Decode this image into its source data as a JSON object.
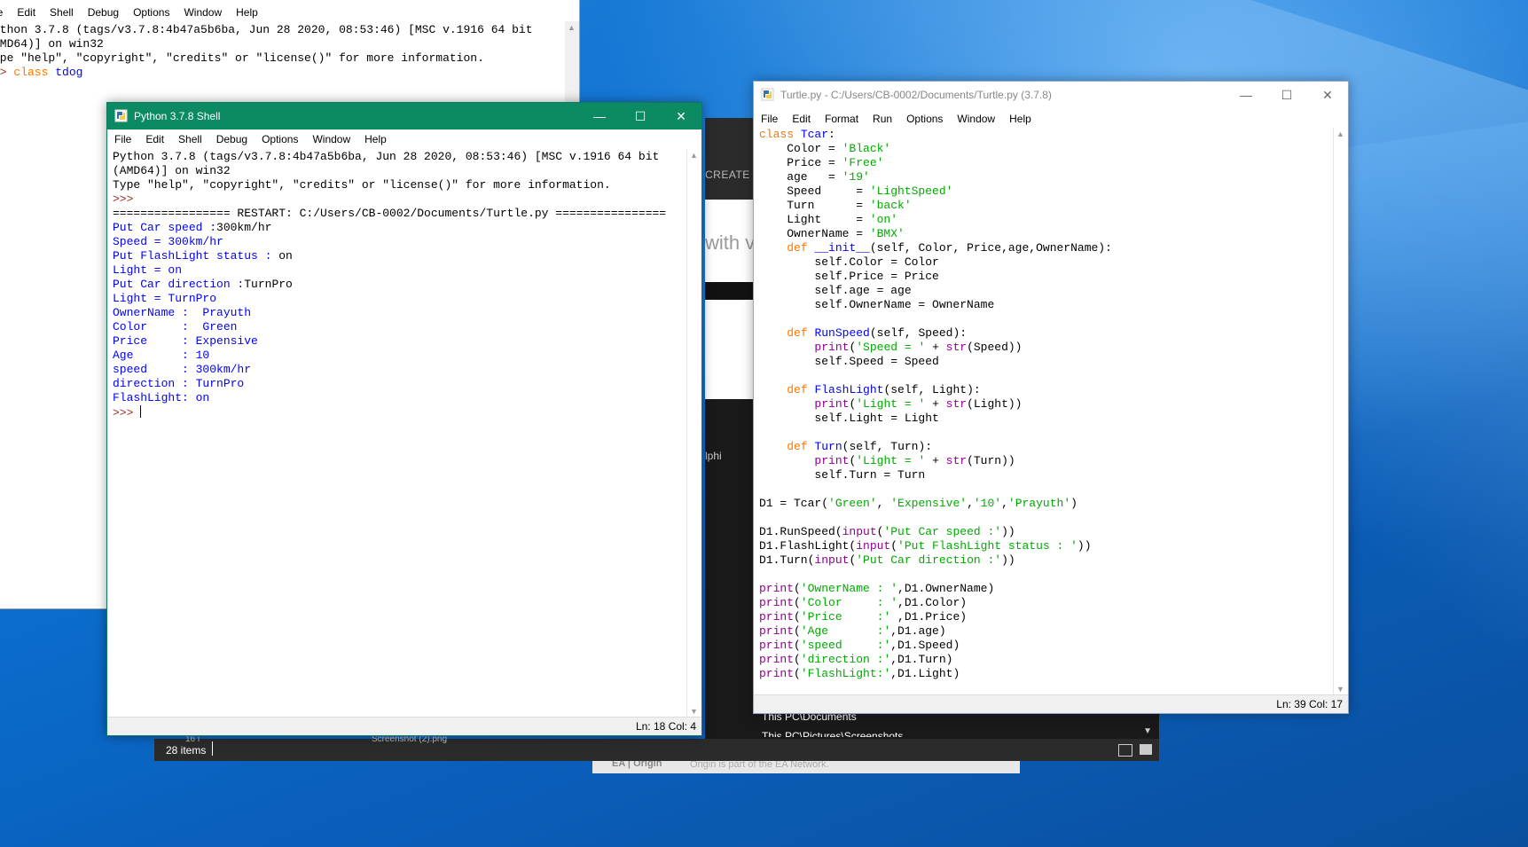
{
  "bg_shell": {
    "menu": [
      "le",
      "Edit",
      "Shell",
      "Debug",
      "Options",
      "Window",
      "Help"
    ],
    "lines": [
      [
        {
          "t": "ython 3.7.8 (tags/v3.7.8:4b47a5b6ba, Jun 28 2020, 08:53:46) [MSC v.1916 64 bit",
          "c": "blk"
        }
      ],
      [
        {
          "t": "AMD64)] on win32",
          "c": "blk"
        }
      ],
      [
        {
          "t": "ype \"help\", \"copyright\", \"credits\" or \"license()\" for more information.",
          "c": "blk"
        }
      ],
      [
        {
          "t": ">> ",
          "c": "prompt"
        },
        {
          "t": "class ",
          "c": "kw"
        },
        {
          "t": "tdog",
          "c": "def"
        }
      ]
    ]
  },
  "explorer": {
    "create_label": "CREATE A",
    "with_text": "with v",
    "lphi_text": "lphi",
    "path_documents": "This PC\\Documents",
    "path_screenshots": "This PC\\Pictures\\Screenshots",
    "item_count": "28 items",
    "partial_left": "16 i",
    "partial_file": "Screenshot (2).png"
  },
  "origin_strip": {
    "logo": "EA | Origin",
    "text": "Origin is part of the EA Network."
  },
  "shell": {
    "title": "Python 3.7.8 Shell",
    "menu": [
      "File",
      "Edit",
      "Shell",
      "Debug",
      "Options",
      "Window",
      "Help"
    ],
    "status": "Ln: 18   Col: 4",
    "lines": [
      [
        {
          "t": "Python 3.7.8 (tags/v3.7.8:4b47a5b6ba, Jun 28 2020, 08:53:46) [MSC v.1916 64 bit",
          "c": "blk"
        }
      ],
      [
        {
          "t": "(AMD64)] on win32",
          "c": "blk"
        }
      ],
      [
        {
          "t": "Type \"help\", \"copyright\", \"credits\" or \"license()\" for more information.",
          "c": "blk"
        }
      ],
      [
        {
          "t": ">>> ",
          "c": "prompt"
        }
      ],
      [
        {
          "t": "================= RESTART: C:/Users/CB-0002/Documents/Turtle.py ================",
          "c": "blk"
        }
      ],
      [
        {
          "t": "Put Car speed :",
          "c": "out"
        },
        {
          "t": "300km/hr",
          "c": "blk"
        }
      ],
      [
        {
          "t": "Speed = 300km/hr",
          "c": "out"
        }
      ],
      [
        {
          "t": "Put FlashLight status : ",
          "c": "out"
        },
        {
          "t": "on",
          "c": "blk"
        }
      ],
      [
        {
          "t": "Light = on",
          "c": "out"
        }
      ],
      [
        {
          "t": "Put Car direction :",
          "c": "out"
        },
        {
          "t": "TurnPro",
          "c": "blk"
        }
      ],
      [
        {
          "t": "Light = TurnPro",
          "c": "out"
        }
      ],
      [
        {
          "t": "OwnerName :  Prayuth",
          "c": "out"
        }
      ],
      [
        {
          "t": "Color     :  Green",
          "c": "out"
        }
      ],
      [
        {
          "t": "Price     : Expensive",
          "c": "out"
        }
      ],
      [
        {
          "t": "Age       : 10",
          "c": "out"
        }
      ],
      [
        {
          "t": "speed     : 300km/hr",
          "c": "out"
        }
      ],
      [
        {
          "t": "direction : TurnPro",
          "c": "out"
        }
      ],
      [
        {
          "t": "FlashLight: on",
          "c": "out"
        }
      ],
      [
        {
          "t": ">>> ",
          "c": "prompt"
        },
        {
          "t": "",
          "c": "caret"
        }
      ]
    ]
  },
  "editor": {
    "title": "Turtle.py - C:/Users/CB-0002/Documents/Turtle.py (3.7.8)",
    "menu": [
      "File",
      "Edit",
      "Format",
      "Run",
      "Options",
      "Window",
      "Help"
    ],
    "status": "Ln: 39   Col: 17",
    "lines": [
      [
        {
          "t": "class ",
          "c": "kw"
        },
        {
          "t": "Tcar",
          "c": "def"
        },
        {
          "t": ":",
          "c": "blk"
        }
      ],
      [
        {
          "t": "    Color = ",
          "c": "blk"
        },
        {
          "t": "'Black'",
          "c": "str"
        }
      ],
      [
        {
          "t": "    Price = ",
          "c": "blk"
        },
        {
          "t": "'Free'",
          "c": "str"
        }
      ],
      [
        {
          "t": "    age   = ",
          "c": "blk"
        },
        {
          "t": "'19'",
          "c": "str"
        }
      ],
      [
        {
          "t": "    Speed     = ",
          "c": "blk"
        },
        {
          "t": "'LightSpeed'",
          "c": "str"
        }
      ],
      [
        {
          "t": "    Turn      = ",
          "c": "blk"
        },
        {
          "t": "'back'",
          "c": "str"
        }
      ],
      [
        {
          "t": "    Light     = ",
          "c": "blk"
        },
        {
          "t": "'on'",
          "c": "str"
        }
      ],
      [
        {
          "t": "    OwnerName = ",
          "c": "blk"
        },
        {
          "t": "'BMX'",
          "c": "str"
        }
      ],
      [
        {
          "t": "    ",
          "c": "blk"
        },
        {
          "t": "def ",
          "c": "kw"
        },
        {
          "t": "__init__",
          "c": "def"
        },
        {
          "t": "(self, Color, Price,age,OwnerName):",
          "c": "blk"
        }
      ],
      [
        {
          "t": "        self.Color = Color",
          "c": "blk"
        }
      ],
      [
        {
          "t": "        self.Price = Price",
          "c": "blk"
        }
      ],
      [
        {
          "t": "        self.age = age",
          "c": "blk"
        }
      ],
      [
        {
          "t": "        self.OwnerName = OwnerName",
          "c": "blk"
        }
      ],
      [
        {
          "t": "",
          "c": "blk"
        }
      ],
      [
        {
          "t": "    ",
          "c": "blk"
        },
        {
          "t": "def ",
          "c": "kw"
        },
        {
          "t": "RunSpeed",
          "c": "def"
        },
        {
          "t": "(self, Speed):",
          "c": "blk"
        }
      ],
      [
        {
          "t": "        ",
          "c": "blk"
        },
        {
          "t": "print",
          "c": "bi"
        },
        {
          "t": "(",
          "c": "blk"
        },
        {
          "t": "'Speed = '",
          "c": "str"
        },
        {
          "t": " + ",
          "c": "blk"
        },
        {
          "t": "str",
          "c": "bi"
        },
        {
          "t": "(Speed))",
          "c": "blk"
        }
      ],
      [
        {
          "t": "        self.Speed = Speed",
          "c": "blk"
        }
      ],
      [
        {
          "t": "",
          "c": "blk"
        }
      ],
      [
        {
          "t": "    ",
          "c": "blk"
        },
        {
          "t": "def ",
          "c": "kw"
        },
        {
          "t": "FlashLight",
          "c": "def"
        },
        {
          "t": "(self, Light):",
          "c": "blk"
        }
      ],
      [
        {
          "t": "        ",
          "c": "blk"
        },
        {
          "t": "print",
          "c": "bi"
        },
        {
          "t": "(",
          "c": "blk"
        },
        {
          "t": "'Light = '",
          "c": "str"
        },
        {
          "t": " + ",
          "c": "blk"
        },
        {
          "t": "str",
          "c": "bi"
        },
        {
          "t": "(Light))",
          "c": "blk"
        }
      ],
      [
        {
          "t": "        self.Light = Light",
          "c": "blk"
        }
      ],
      [
        {
          "t": "",
          "c": "blk"
        }
      ],
      [
        {
          "t": "    ",
          "c": "blk"
        },
        {
          "t": "def ",
          "c": "kw"
        },
        {
          "t": "Turn",
          "c": "def"
        },
        {
          "t": "(self, Turn):",
          "c": "blk"
        }
      ],
      [
        {
          "t": "        ",
          "c": "blk"
        },
        {
          "t": "print",
          "c": "bi"
        },
        {
          "t": "(",
          "c": "blk"
        },
        {
          "t": "'Light = '",
          "c": "str"
        },
        {
          "t": " + ",
          "c": "blk"
        },
        {
          "t": "str",
          "c": "bi"
        },
        {
          "t": "(Turn))",
          "c": "blk"
        }
      ],
      [
        {
          "t": "        self.Turn = Turn",
          "c": "blk"
        }
      ],
      [
        {
          "t": "",
          "c": "blk"
        }
      ],
      [
        {
          "t": "D1 = Tcar(",
          "c": "blk"
        },
        {
          "t": "'Green'",
          "c": "str"
        },
        {
          "t": ", ",
          "c": "blk"
        },
        {
          "t": "'Expensive'",
          "c": "str"
        },
        {
          "t": ",",
          "c": "blk"
        },
        {
          "t": "'10'",
          "c": "str"
        },
        {
          "t": ",",
          "c": "blk"
        },
        {
          "t": "'Prayuth'",
          "c": "str"
        },
        {
          "t": ")",
          "c": "blk"
        }
      ],
      [
        {
          "t": "",
          "c": "blk"
        }
      ],
      [
        {
          "t": "D1.RunSpeed(",
          "c": "blk"
        },
        {
          "t": "input",
          "c": "bi"
        },
        {
          "t": "(",
          "c": "blk"
        },
        {
          "t": "'Put Car speed :'",
          "c": "str"
        },
        {
          "t": "))",
          "c": "blk"
        }
      ],
      [
        {
          "t": "D1.FlashLight(",
          "c": "blk"
        },
        {
          "t": "input",
          "c": "bi"
        },
        {
          "t": "(",
          "c": "blk"
        },
        {
          "t": "'Put FlashLight status : '",
          "c": "str"
        },
        {
          "t": "))",
          "c": "blk"
        }
      ],
      [
        {
          "t": "D1.Turn(",
          "c": "blk"
        },
        {
          "t": "input",
          "c": "bi"
        },
        {
          "t": "(",
          "c": "blk"
        },
        {
          "t": "'Put Car direction :'",
          "c": "str"
        },
        {
          "t": "))",
          "c": "blk"
        }
      ],
      [
        {
          "t": "",
          "c": "blk"
        }
      ],
      [
        {
          "t": "print",
          "c": "bi"
        },
        {
          "t": "(",
          "c": "blk"
        },
        {
          "t": "'OwnerName : '",
          "c": "str"
        },
        {
          "t": ",D1.OwnerName)",
          "c": "blk"
        }
      ],
      [
        {
          "t": "print",
          "c": "bi"
        },
        {
          "t": "(",
          "c": "blk"
        },
        {
          "t": "'Color     : '",
          "c": "str"
        },
        {
          "t": ",D1.Color)",
          "c": "blk"
        }
      ],
      [
        {
          "t": "print",
          "c": "bi"
        },
        {
          "t": "(",
          "c": "blk"
        },
        {
          "t": "'Price     :'",
          "c": "str"
        },
        {
          "t": " ,D1.Price)",
          "c": "blk"
        }
      ],
      [
        {
          "t": "print",
          "c": "bi"
        },
        {
          "t": "(",
          "c": "blk"
        },
        {
          "t": "'Age       :'",
          "c": "str"
        },
        {
          "t": ",D1.age)",
          "c": "blk"
        }
      ],
      [
        {
          "t": "print",
          "c": "bi"
        },
        {
          "t": "(",
          "c": "blk"
        },
        {
          "t": "'speed     :'",
          "c": "str"
        },
        {
          "t": ",D1.Speed)",
          "c": "blk"
        }
      ],
      [
        {
          "t": "print",
          "c": "bi"
        },
        {
          "t": "(",
          "c": "blk"
        },
        {
          "t": "'direction :'",
          "c": "str"
        },
        {
          "t": ",D1.Turn)",
          "c": "blk"
        }
      ],
      [
        {
          "t": "print",
          "c": "bi"
        },
        {
          "t": "(",
          "c": "blk"
        },
        {
          "t": "'FlashLight:'",
          "c": "str"
        },
        {
          "t": ",D1.Light)",
          "c": "blk"
        }
      ]
    ]
  },
  "colors": {
    "shell_titlebar": "#0b8a63",
    "keyword": "#ff7700",
    "definition": "#0000ff",
    "string": "#00aa00",
    "builtin": "#900090",
    "stdout": "#0000ff",
    "prompt": "#a52a2a"
  },
  "icons": {
    "window_minimize": "minimize-icon",
    "window_maximize": "maximize-icon",
    "window_close": "close-icon",
    "idle": "python-idle-icon"
  }
}
